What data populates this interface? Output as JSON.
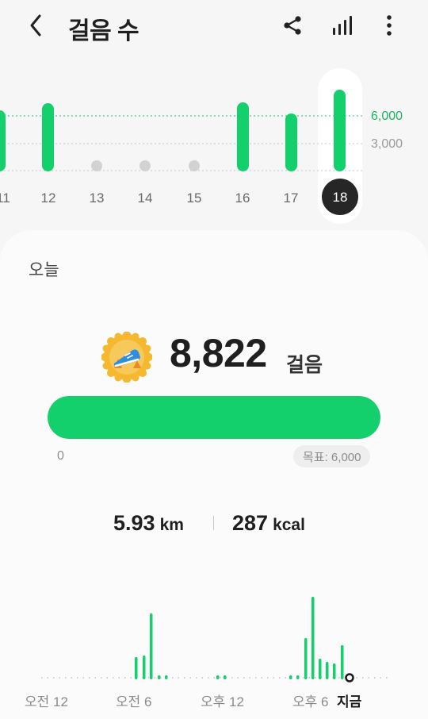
{
  "header": {
    "title": "걸음 수",
    "icons": {
      "back": "chevron-left-icon",
      "share": "share-icon",
      "chart": "bar-chart-icon",
      "more": "more-vertical-icon"
    }
  },
  "weekly": {
    "days": [
      "11",
      "12",
      "13",
      "14",
      "15",
      "16",
      "17",
      "18"
    ],
    "selected_day": "18",
    "goal_label": "6,000",
    "mid_label": "3,000"
  },
  "today": {
    "label": "오늘",
    "steps": "8,822",
    "steps_unit": "걸음",
    "progress": 1.0,
    "min_label": "0",
    "goal_label": "목표: 6,000",
    "badge_icon": "running-shoe-badge-icon"
  },
  "stats": {
    "distance": "5.93",
    "distance_unit": "km",
    "calories": "287",
    "calories_unit": "kcal"
  },
  "daily": {
    "time_labels": [
      "오전 12",
      "오전 6",
      "오후 12",
      "오후 6",
      "지금"
    ]
  },
  "colors": {
    "accent": "#14D06C",
    "goal_text": "#17B862",
    "selected": "#262626"
  }
}
